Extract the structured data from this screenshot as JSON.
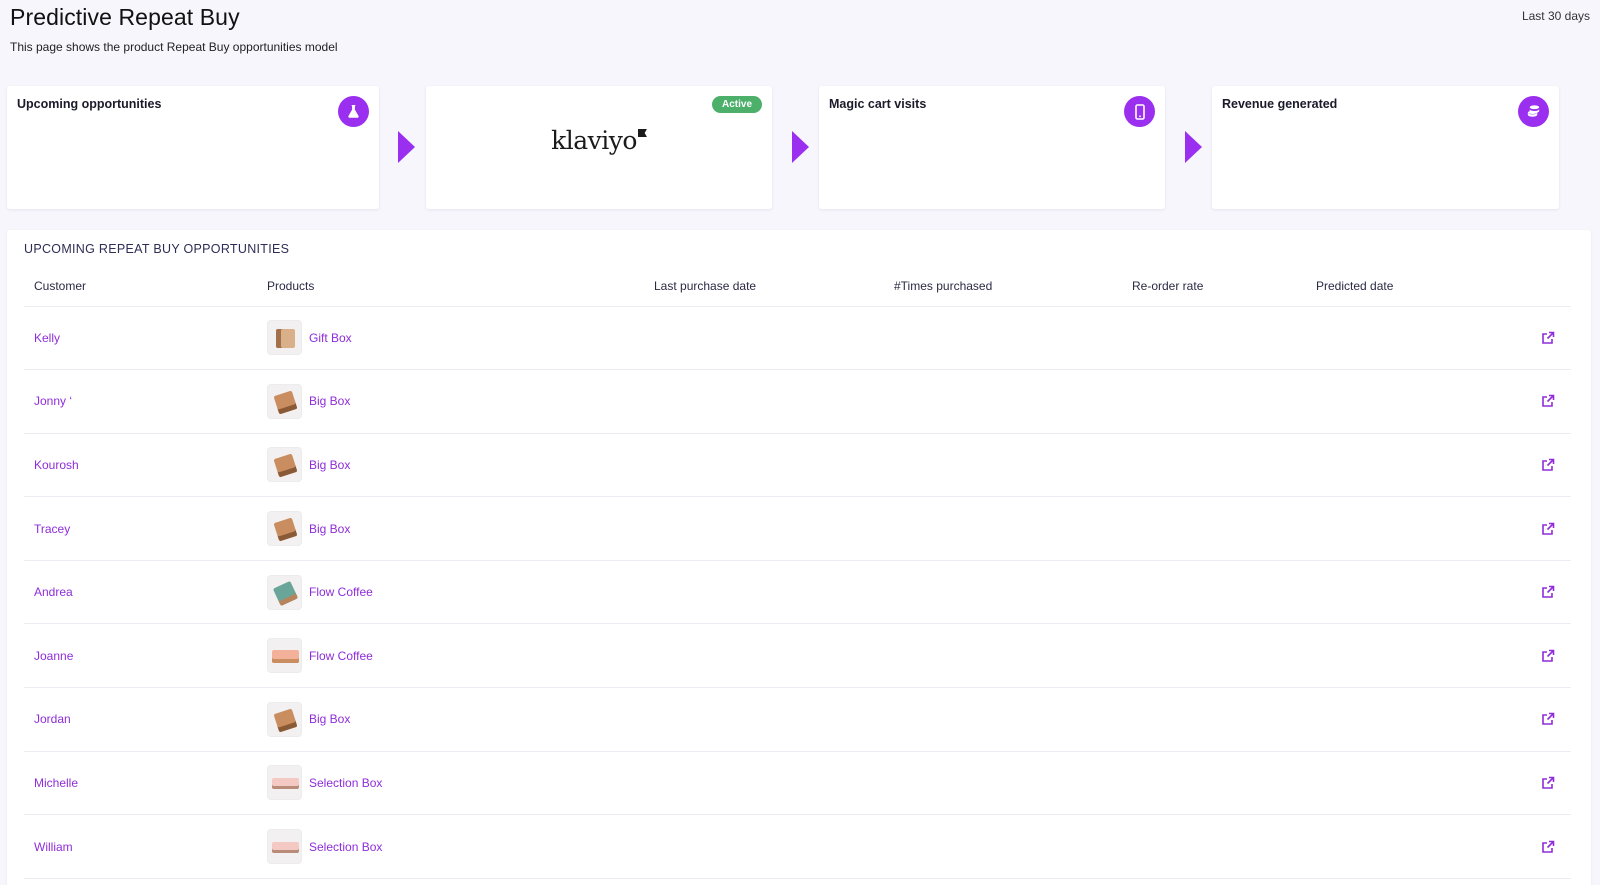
{
  "header": {
    "title": "Predictive Repeat Buy",
    "subtitle": "This page shows the product Repeat Buy opportunities model",
    "date_range": "Last 30 days"
  },
  "funnel": {
    "upcoming": {
      "title": "Upcoming opportunities",
      "icon": "flask-icon"
    },
    "klaviyo": {
      "logo_text": "klaviyo",
      "badge": "Active"
    },
    "magic_cart": {
      "title": "Magic cart visits",
      "icon": "smartphone-icon"
    },
    "revenue": {
      "title": "Revenue generated",
      "icon": "coins-icon"
    }
  },
  "table": {
    "heading": "UPCOMING REPEAT BUY OPPORTUNITIES",
    "columns": [
      "Customer",
      "Products",
      "Last purchase date",
      "#Times purchased",
      "Re-order rate",
      "Predicted date"
    ],
    "rows": [
      {
        "customer": "Kelly",
        "product": "Gift Box"
      },
      {
        "customer": "Jonny ‘",
        "product": "Big Box"
      },
      {
        "customer": "Kourosh",
        "product": "Big Box"
      },
      {
        "customer": "Tracey",
        "product": "Big Box"
      },
      {
        "customer": "Andrea",
        "product": "Flow Coffee"
      },
      {
        "customer": "Joanne",
        "product": "Flow Coffee"
      },
      {
        "customer": "Jordan",
        "product": "Big Box"
      },
      {
        "customer": "Michelle",
        "product": "Selection Box"
      },
      {
        "customer": "William",
        "product": "Selection Box"
      }
    ]
  },
  "colors": {
    "accent": "#9b2ff0",
    "link": "#8e2dd9",
    "active_badge": "#4caf6a",
    "background": "#f7f6fc"
  }
}
